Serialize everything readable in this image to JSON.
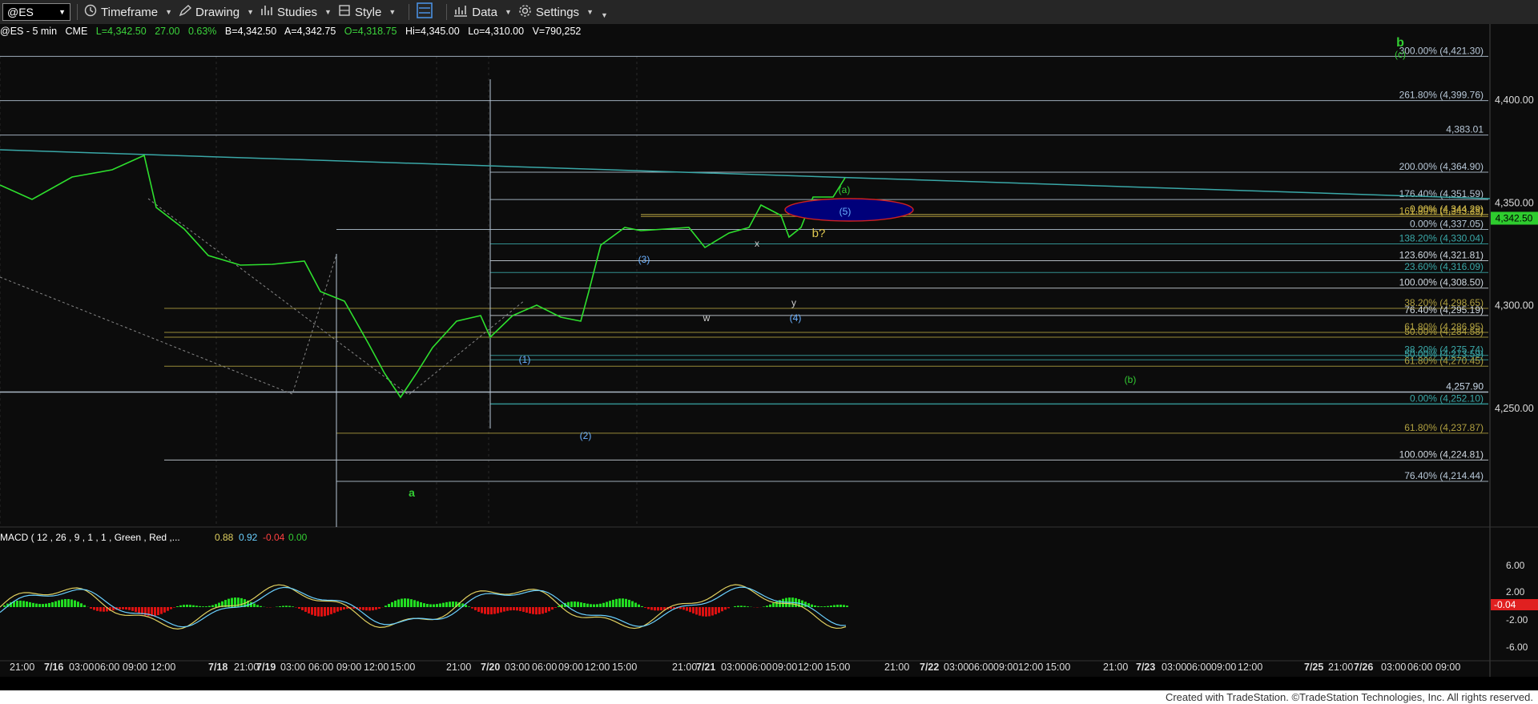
{
  "toolbar": {
    "symbol": "@ES",
    "timeframe_label": "Timeframe",
    "drawing_label": "Drawing",
    "studies_label": "Studies",
    "style_label": "Style",
    "data_label": "Data",
    "settings_label": "Settings"
  },
  "status_bar": {
    "symbol_interval": "@ES - 5 min",
    "exchange": "CME",
    "last": "L=4,342.50",
    "change": "27.00",
    "change_pct": "0.63%",
    "bid": "B=4,342.50",
    "ask": "A=4,342.75",
    "open": "O=4,318.75",
    "high": "Hi=4,345.00",
    "low": "Lo=4,310.00",
    "volume": "V=790,252"
  },
  "price_axis": {
    "ticks": [
      "4,400.00",
      "4,350.00",
      "4,300.00",
      "4,250.00"
    ],
    "current_price": "4,342.50",
    "current_color": "#2ecc2e"
  },
  "fib_levels": [
    {
      "label": "300.00% (4,421.30)",
      "price": 4421.3,
      "color": "#b8c8d8"
    },
    {
      "label": "261.80% (4,399.76)",
      "price": 4399.76,
      "color": "#b8c8d8"
    },
    {
      "label": "4,383.01",
      "price": 4383.01,
      "color": "#b8c8d8"
    },
    {
      "label": "200.00% (4,364.90)",
      "price": 4364.9,
      "color": "#b8c8d8"
    },
    {
      "label": "176.40% (4,351.59)",
      "price": 4351.59,
      "color": "#b8c8d8"
    },
    {
      "label": "0.00% (4,344.29)",
      "price": 4344.29,
      "color": "#e0c850"
    },
    {
      "label": "161.80% (4,343.35)",
      "price": 4343.35,
      "color": "#c8b040"
    },
    {
      "label": "0.00% (4,337.05)",
      "price": 4337.05,
      "color": "#b8c8d8"
    },
    {
      "label": "138.20% (4,330.04)",
      "price": 4330.04,
      "color": "#3aa8a8"
    },
    {
      "label": "123.60% (4,321.81)",
      "price": 4321.81,
      "color": "#d0d8e0"
    },
    {
      "label": "23.60% (4,316.09)",
      "price": 4316.09,
      "color": "#3aa8a8"
    },
    {
      "label": "100.00% (4,308.50)",
      "price": 4308.5,
      "color": "#d0d8e0"
    },
    {
      "label": "38.20% (4,298.65)",
      "price": 4298.65,
      "color": "#b0a040"
    },
    {
      "label": "76.40% (4,295.19)",
      "price": 4295.19,
      "color": "#d0d8e0"
    },
    {
      "label": "61.80% (4,286.95)",
      "price": 4286.95,
      "color": "#b0a040"
    },
    {
      "label": "50.00% (4,284.58)",
      "price": 4284.58,
      "color": "#b0a040"
    },
    {
      "label": "38.20% (4,275.74)",
      "price": 4275.74,
      "color": "#3aa8a8"
    },
    {
      "label": "50.00% (4,273.59)",
      "price": 4273.59,
      "color": "#3aa8a8"
    },
    {
      "label": "61.80% (4,270.45)",
      "price": 4270.45,
      "color": "#b0a040"
    },
    {
      "label": "4,257.90",
      "price": 4257.9,
      "color": "#c8d8e8"
    },
    {
      "label": "0.00% (4,252.10)",
      "price": 4252.1,
      "color": "#3aa8a8"
    },
    {
      "label": "61.80% (4,237.87)",
      "price": 4237.87,
      "color": "#b0a040"
    },
    {
      "label": "100.00% (4,224.81)",
      "price": 4224.81,
      "color": "#d0d8e0"
    },
    {
      "label": "76.40% (4,214.44)",
      "price": 4214.44,
      "color": "#b8c8d8"
    }
  ],
  "wave_labels": [
    {
      "text": "b",
      "color": "#33cc33"
    },
    {
      "text": "(c)",
      "color": "#33cc33"
    },
    {
      "text": "(a)",
      "color": "#33cc33"
    },
    {
      "text": "(5)",
      "color": "#6ab0ff"
    },
    {
      "text": "b?",
      "color": "#e0c850"
    },
    {
      "text": "x",
      "color": "#cccccc"
    },
    {
      "text": "(3)",
      "color": "#6ab0ff"
    },
    {
      "text": "w",
      "color": "#cccccc"
    },
    {
      "text": "y",
      "color": "#cccccc"
    },
    {
      "text": "(4)",
      "color": "#6ab0ff"
    },
    {
      "text": "(1)",
      "color": "#6ab0ff"
    },
    {
      "text": "(2)",
      "color": "#6ab0ff"
    },
    {
      "text": "a",
      "color": "#33cc33"
    },
    {
      "text": "(b)",
      "color": "#33cc33"
    }
  ],
  "macd": {
    "title": "MACD ( 12 , 26 , 9 , 1 , 1 , Green , Red ,...",
    "value1": "0.88",
    "value2": "0.92",
    "value3": "-0.04",
    "value4": "0.00",
    "axis_ticks": [
      "6.00",
      "2.00",
      "-2.00",
      "-6.00"
    ],
    "current": "-0.04"
  },
  "time_axis": {
    "labels": [
      "21:00",
      "7/16",
      "03:00",
      "06:00",
      "09:00",
      "12:00",
      "7/18",
      "21:00",
      "7/19",
      "03:00",
      "06:00",
      "09:00",
      "12:00",
      "15:00",
      "21:00",
      "7/20",
      "03:00",
      "06:00",
      "09:00",
      "12:00",
      "15:00",
      "21:00",
      "7/21",
      "03:00",
      "06:00",
      "09:00",
      "12:00",
      "15:00",
      "21:00",
      "7/22",
      "03:00",
      "06:00",
      "09:00",
      "12:00",
      "15:00",
      "21:00",
      "7/23",
      "03:00",
      "06:00",
      "09:00",
      "12:00",
      "7/25",
      "21:00",
      "7/26",
      "03:00",
      "06:00",
      "09:00"
    ]
  },
  "footer_text": "Created with TradeStation. ©TradeStation Technologies, Inc. All rights reserved."
}
